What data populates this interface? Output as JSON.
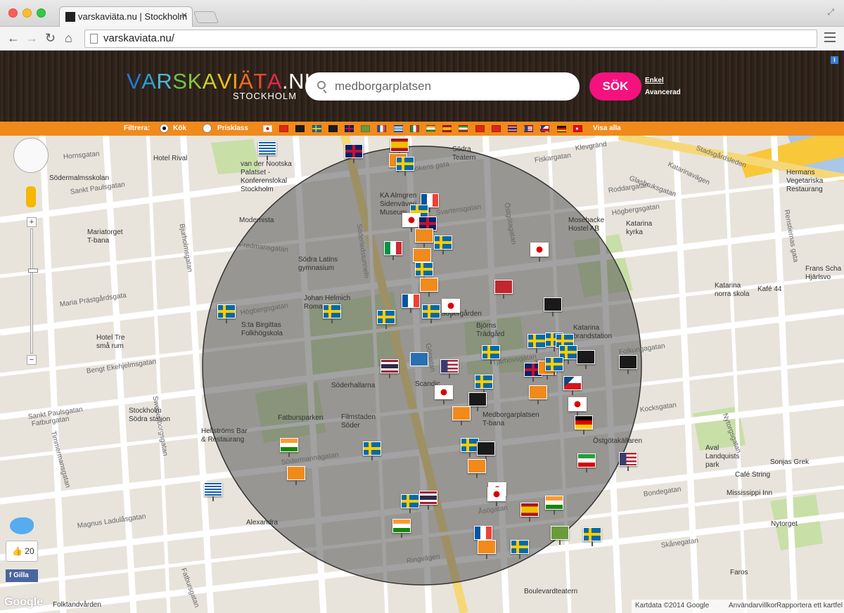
{
  "browser": {
    "tab_title": "varskaviäta.nu | Stockholm",
    "url": "varskaviata.nu/"
  },
  "header": {
    "logo_letters": [
      "V",
      "A",
      "R",
      "S",
      "K",
      "A",
      "V",
      "I",
      "Ä",
      "T",
      "A",
      ".",
      "N",
      "U"
    ],
    "logo_colors": [
      "#1e7fd4",
      "#2a9fd6",
      "#4ab8d8",
      "#6ec24a",
      "#8ac53f",
      "#c6d12e",
      "#f2c21a",
      "#f59b1f",
      "#f26b22",
      "#e84a2c",
      "#e2294f",
      "#ffffff",
      "#ffffff",
      "#ffffff"
    ],
    "logo_sub": "STOCKHOLM",
    "search_value": "medborgarplatsen",
    "search_button": "SÖK",
    "mode_simple": "Enkel",
    "mode_advanced": "Avancerad",
    "info_icon": "i"
  },
  "filter": {
    "label": "Filtrera:",
    "option_kitchen": "Kök",
    "option_price": "Prisklass",
    "show_all": "Visa alla",
    "flags": [
      "japan",
      "china",
      "coffee-cup",
      "sweden",
      "coffee-cup",
      "uk",
      "veg",
      "france",
      "greece",
      "italy",
      "india",
      "spain",
      "iran",
      "china",
      "vietnam",
      "thailand",
      "usa",
      "czech",
      "germany",
      "turkey"
    ]
  },
  "map": {
    "labels": [
      {
        "text": "Hotel Rival"
      },
      {
        "text": "Södermalmsskolan"
      },
      {
        "text": "Mariatorget\nT-bana"
      },
      {
        "text": "van der Nootska\nPalatset -\nKonferenslokal\nStockholm"
      },
      {
        "text": "Modernista"
      },
      {
        "text": "Södra Latins\ngymnasium"
      },
      {
        "text": "KA Almgren\nSidenväveri\nMuseum"
      },
      {
        "text": "Södra\nTeatern"
      },
      {
        "text": "Mosebacke\nHostel AB"
      },
      {
        "text": "Katarina\nkyrka"
      },
      {
        "text": "Hermans\nVegetariska\nRestaurang"
      },
      {
        "text": "Frans Scha\nHjärlsvo"
      },
      {
        "text": "Katarina\nnorra skola"
      },
      {
        "text": "Kafé 44"
      },
      {
        "text": "Katarina\nbrandstation"
      },
      {
        "text": "Björns\nTrädgård"
      },
      {
        "text": "S:ta Birgittas\nFolkhögskola"
      },
      {
        "text": "Hotel Tre\nsmå rum"
      },
      {
        "text": "Stockholm\nSödra station"
      },
      {
        "text": "Hellströms Bar\n& Restaurang"
      },
      {
        "text": "Fatbursparken"
      },
      {
        "text": "Söderhallarna"
      },
      {
        "text": "Filmstaden\nSöder"
      },
      {
        "text": "Medborgarplatsen\nT-bana"
      },
      {
        "text": "Östgötakällaren"
      },
      {
        "text": "Aval\nLandquists\npark"
      },
      {
        "text": "Sonjas Grek"
      },
      {
        "text": "Café String"
      },
      {
        "text": "Mississippi Inn"
      },
      {
        "text": "Nytorget"
      },
      {
        "text": "Faros"
      },
      {
        "text": "Boulevardteatern"
      },
      {
        "text": "Alexandra"
      },
      {
        "text": "Folktandvården"
      },
      {
        "text": "Johan Helmich\nRoman park"
      },
      {
        "text": "Södergården"
      },
      {
        "text": "Scandic"
      }
    ],
    "streets": [
      {
        "text": "Hornsgatan"
      },
      {
        "text": "Sankt Paulsgatan"
      },
      {
        "text": "Bjurholmsgatan"
      },
      {
        "text": "Fredmansgatan"
      },
      {
        "text": "Maria Prästgårdsgata"
      },
      {
        "text": "Timmermansgatan"
      },
      {
        "text": "Högbergsgatan"
      },
      {
        "text": "Bengt Ekehjelmsgatan"
      },
      {
        "text": "Swedenborgsgatan"
      },
      {
        "text": "Fatburgatan"
      },
      {
        "text": "Fatbursgatan"
      },
      {
        "text": "Magnus Ladulåsgatan"
      },
      {
        "text": "Sankt Paulsgatan"
      },
      {
        "text": "Södermannagatan"
      },
      {
        "text": "Hökens gata"
      },
      {
        "text": "Svartensgatan"
      },
      {
        "text": "Katarinavägen"
      },
      {
        "text": "Fiskargatan"
      },
      {
        "text": "Roddargatan"
      },
      {
        "text": "Högbergsgatan"
      },
      {
        "text": "Folkungagatan"
      },
      {
        "text": "Kocksgatan"
      },
      {
        "text": "Åsögatan"
      },
      {
        "text": "Bondegatan"
      },
      {
        "text": "Skånegatan"
      },
      {
        "text": "Renstiernas gata"
      },
      {
        "text": "Nytorgsgatan"
      },
      {
        "text": "Götgatan"
      },
      {
        "text": "Östgötagatan"
      },
      {
        "text": "Söderledstunneln"
      },
      {
        "text": "Stadsgårdsleden"
      },
      {
        "text": "Glasbruksgatan"
      },
      {
        "text": "Klevgränd"
      },
      {
        "text": "Tjärhovsgatan"
      },
      {
        "text": "Ringvägen"
      },
      {
        "text": "Tjärhovsgatan"
      }
    ],
    "zoom_in": "+",
    "zoom_out": "−",
    "like_count": "20",
    "gilla": "Gilla",
    "google": "Google",
    "attribution": "Kartdata ©2014 Google",
    "terms": "Användarvillkor",
    "report": "Rapportera ett kartfel",
    "search_radius_center": "Medborgarplatsen"
  },
  "colors": {
    "header_bg": "#2a2019",
    "filter_bg": "#f08a1b",
    "search_button": "#f5127e",
    "radius_fill": "#555555"
  }
}
